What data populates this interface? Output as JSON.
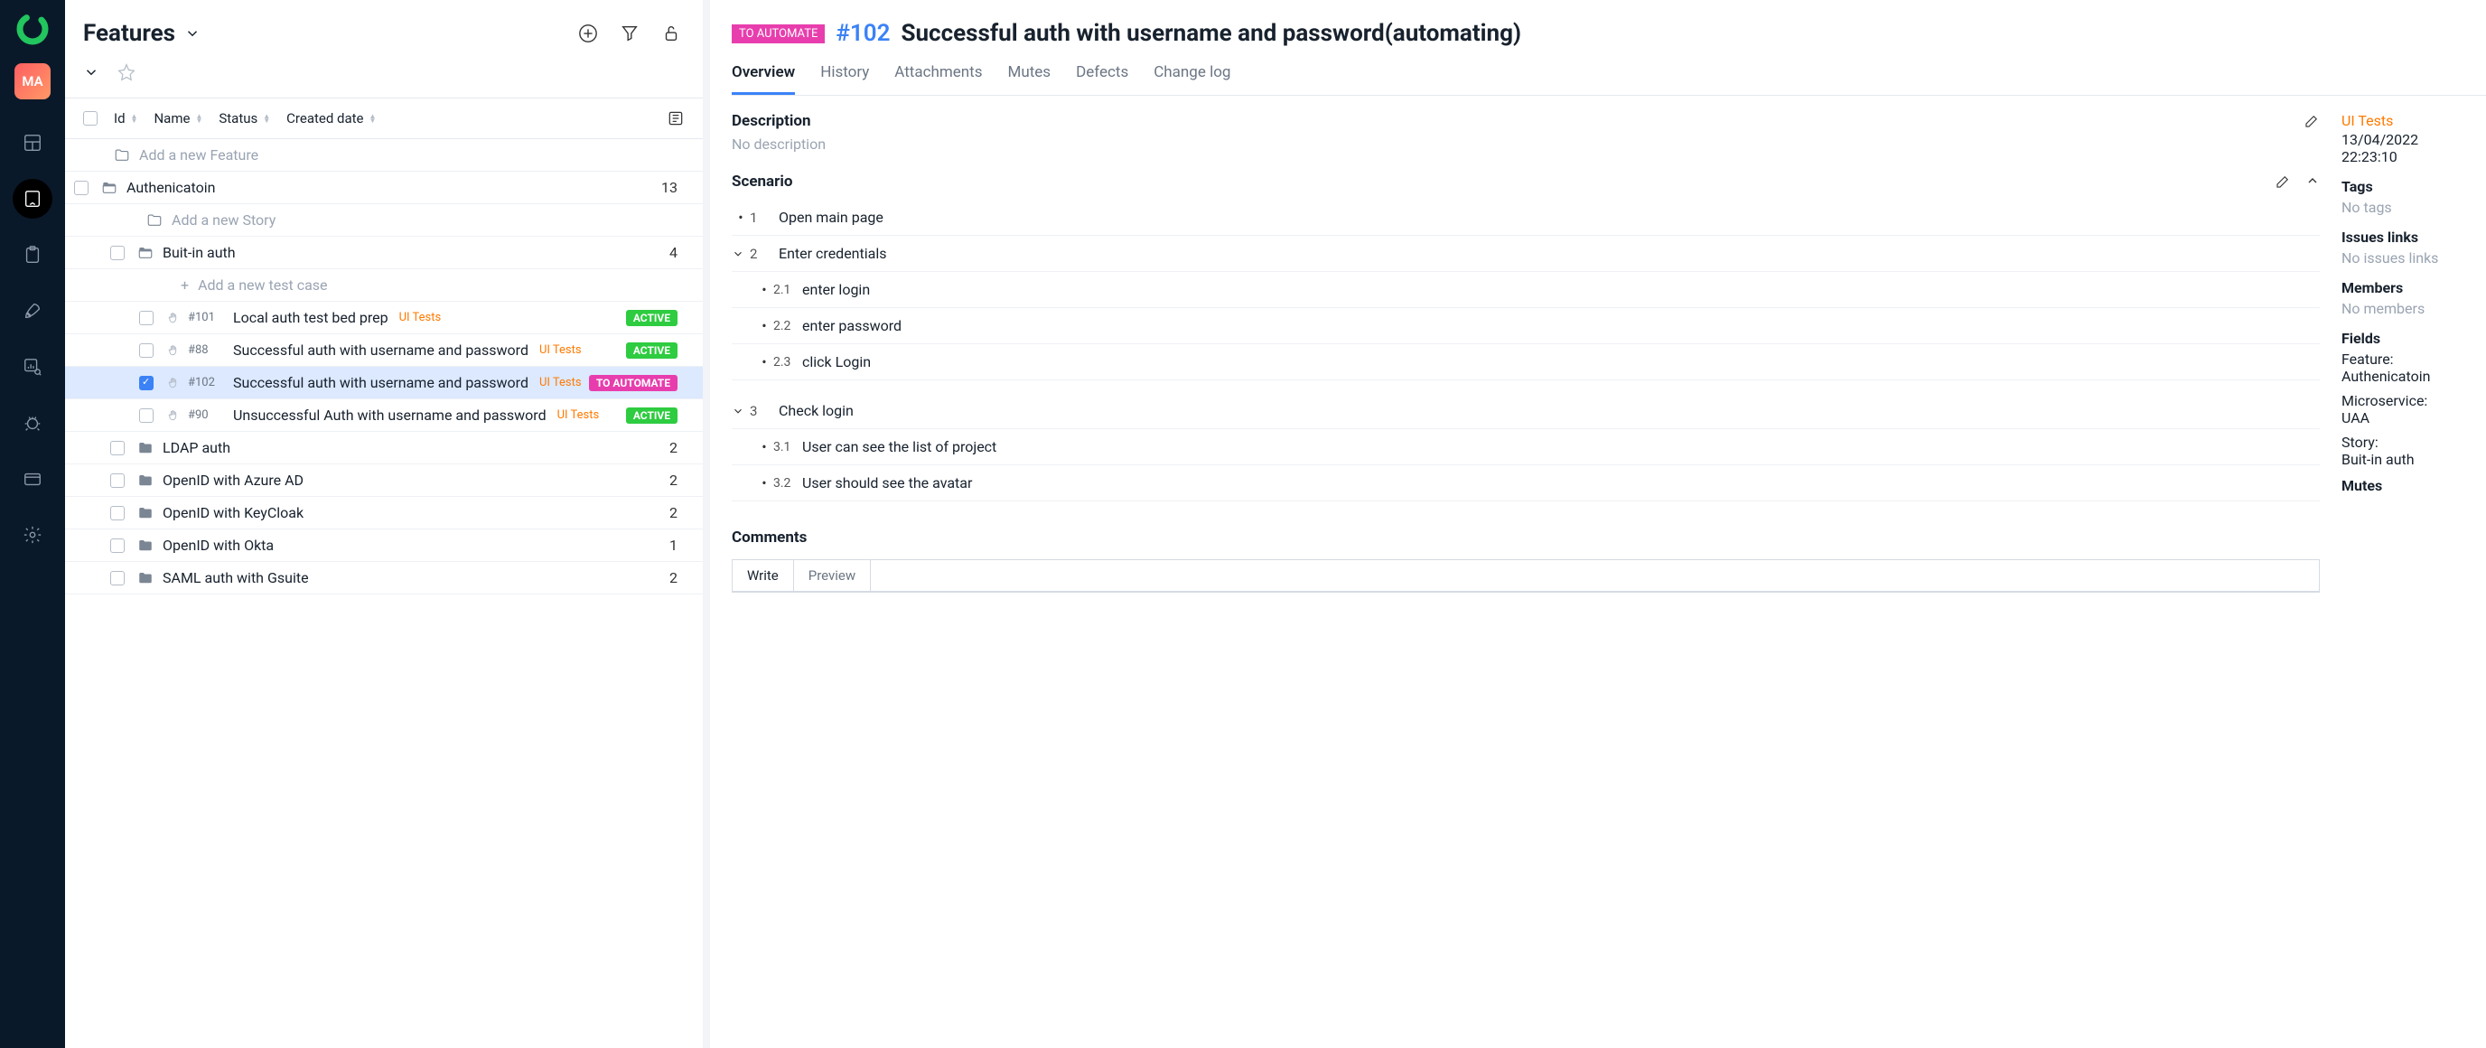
{
  "sidebar": {
    "avatar_initials": "MA"
  },
  "left": {
    "title": "Features",
    "columns": {
      "id": "Id",
      "name": "Name",
      "status": "Status",
      "created": "Created date"
    },
    "add_feature": "Add a new Feature",
    "add_story": "Add a new Story",
    "add_tc": "Add a new test case",
    "tree": {
      "auth": {
        "name": "Authenicatoin",
        "count": "13"
      },
      "builtin": {
        "name": "Buit-in auth",
        "count": "4"
      },
      "ldap": {
        "name": "LDAP auth",
        "count": "2"
      },
      "azure": {
        "name": "OpenID with Azure AD",
        "count": "2"
      },
      "keycloak": {
        "name": "OpenID with KeyCloak",
        "count": "2"
      },
      "okta": {
        "name": "OpenID with Okta",
        "count": "1"
      },
      "saml": {
        "name": "SAML auth with Gsuite",
        "count": "2"
      }
    },
    "tests": [
      {
        "id": "#101",
        "name": "Local auth test bed prep",
        "tag": "UI Tests",
        "status": "ACTIVE",
        "badge_class": "active",
        "checked": false
      },
      {
        "id": "#88",
        "name": "Successful auth with username and password",
        "tag": "UI Tests",
        "status": "ACTIVE",
        "badge_class": "active",
        "checked": false
      },
      {
        "id": "#102",
        "name": "Successful auth with username and password",
        "tag": "UI Tests",
        "status": "TO AUTOMATE",
        "badge_class": "automate",
        "checked": true
      },
      {
        "id": "#90",
        "name": "Unsuccessful Auth with username and password",
        "tag": "UI Tests",
        "status": "ACTIVE",
        "badge_class": "active",
        "checked": false
      }
    ]
  },
  "right": {
    "badge": "TO AUTOMATE",
    "id": "#102",
    "name": "Successful auth with username and password(automating)",
    "tabs": {
      "overview": "Overview",
      "history": "History",
      "attachments": "Attachments",
      "mutes": "Mutes",
      "defects": "Defects",
      "changelog": "Change log"
    },
    "description": {
      "title": "Description",
      "empty": "No description"
    },
    "scenario": {
      "title": "Scenario",
      "steps": {
        "s1": {
          "num": "1",
          "text": "Open main page"
        },
        "s2": {
          "num": "2",
          "text": "Enter credentials"
        },
        "s2_1": {
          "num": "2.1",
          "text": "enter login"
        },
        "s2_2": {
          "num": "2.2",
          "text": "enter password"
        },
        "s2_3": {
          "num": "2.3",
          "text": "click Login"
        },
        "s3": {
          "num": "3",
          "text": "Check login"
        },
        "s3_1": {
          "num": "3.1",
          "text": "User can see the list of project"
        },
        "s3_2": {
          "num": "3.2",
          "text": "User should see the avatar"
        }
      }
    },
    "comments": {
      "title": "Comments",
      "write": "Write",
      "preview": "Preview"
    },
    "meta": {
      "link": "UI Tests",
      "date1": "13/04/2022",
      "date2": "22:23:10",
      "tags_label": "Tags",
      "tags_value": "No tags",
      "issues_label": "Issues links",
      "issues_value": "No issues links",
      "members_label": "Members",
      "members_value": "No members",
      "fields_label": "Fields",
      "feature_label": "Feature:",
      "feature_value": "Authenicatoin",
      "micro_label": "Microservice:",
      "micro_value": "UAA",
      "story_label": "Story:",
      "story_value": "Buit-in auth",
      "mutes_label": "Mutes"
    }
  }
}
